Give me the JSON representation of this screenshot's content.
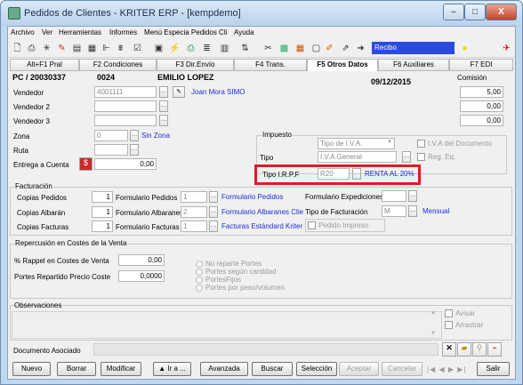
{
  "window": {
    "title": "Pedidos de Clientes - KRITER ERP - [kempdemo]",
    "minimize": "–",
    "maximize": "□",
    "close": "X"
  },
  "menu": [
    "Archivo",
    "Ver",
    "Herramientas",
    "Informes",
    "Menú Especia Pedidos Cli",
    "Ayuda"
  ],
  "toolbar": {
    "combo_value": "Recibo"
  },
  "tabs": [
    "Alt+F1 Pral",
    "F2 Condiciones",
    "F3 Dir.Envío",
    "F4 Trans.",
    "F5 Otros Datos",
    "F6 Auxiliares",
    "F7 EDI"
  ],
  "header": {
    "order": "PC / 20030337",
    "client_code": "0024",
    "client_name": "EMILIO LOPEZ",
    "date": "09/12/2015",
    "commission_label": "Comisión"
  },
  "fields": {
    "vendedor_label": "Vendedor",
    "vendedor_value": "4001111",
    "vendedor_name": "Joan Mora SIMO",
    "vendedor_com": "5,00",
    "vendedor2_label": "Vendedor 2",
    "vendedor2_com": "0,00",
    "vendedor3_label": "Vendedor 3",
    "vendedor3_com": "0,00",
    "zona_label": "Zona",
    "zona_value": "0",
    "zona_name": "Sin Zona",
    "ruta_label": "Ruta",
    "entrega_label": "Entrega a Cuenta",
    "entrega_value": "0,00"
  },
  "impuesto": {
    "title": "Impuesto",
    "tipo_iva_value": "Tipo de I.V.A.",
    "tipo_label": "Tipo",
    "tipo_value": "I.V.A General",
    "irpf_label": "Tipo I.R.P.F",
    "irpf_value": "R20",
    "irpf_name": "RENTA AL 20%",
    "chk_iva_doc": "I.V.A del Documento",
    "chk_reg_eq": "Reg. Eq."
  },
  "facturacion": {
    "title": "Facturación",
    "copias_pedidos_label": "Copias Pedidos",
    "copias_pedidos": "1",
    "form_pedidos_label": "Formulario Pedidos",
    "form_pedidos": "1",
    "form_pedidos_name": "Formulario Pedidos",
    "form_exp_label": "Formulario Expediciones",
    "copias_albaran_label": "Copias Albarán",
    "copias_albaran": "1",
    "form_albaranes_label": "Formulario Albaranes",
    "form_albaranes": "2",
    "form_albaranes_name": "Formulario Albaranes Clien",
    "tipo_fact_label": "Tipo de Facturación",
    "tipo_fact": "M",
    "tipo_fact_name": "Mensual",
    "copias_facturas_label": "Copias Facturas",
    "copias_facturas": "1",
    "form_facturas_label": "Formulario Facturas",
    "form_facturas": "1",
    "form_facturas_name": "Facturas Estándard Kriter I",
    "pedido_impreso": "Pedido Impreso"
  },
  "portes": {
    "title": "Repercusión en Costes de la Venta",
    "rappel_label": "% Rappel en Costes de Venta",
    "rappel_value": "0,00",
    "portes_label": "Portes Repartido Precio Coste",
    "portes_value": "0,0000",
    "options": [
      "No reparte Portes",
      "Portes según cantidad",
      "PortesFijos",
      "Portes por peso/volumen"
    ]
  },
  "observaciones": {
    "title": "Observaciones",
    "avisar": "Avisar",
    "arrastrar": "Arrastrar"
  },
  "documento_label": "Documento Asociado",
  "buttons": [
    "Nuevo",
    "Borrar",
    "Modificar",
    "▲ Ir a ...",
    "Avanzada",
    "Buscar",
    "Selección",
    "Aceptar",
    "Cancelar",
    "Salir"
  ],
  "colors": {
    "link": "#1a2fd4",
    "highlight": "#e01b24",
    "combo_bg": "#2b4be0"
  }
}
